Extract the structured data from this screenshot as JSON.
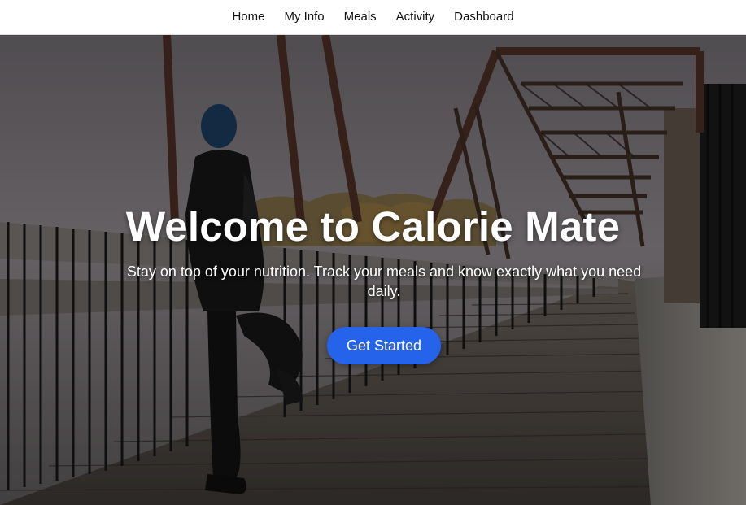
{
  "nav": {
    "items": [
      {
        "label": "Home"
      },
      {
        "label": "My Info"
      },
      {
        "label": "Meals"
      },
      {
        "label": "Activity"
      },
      {
        "label": "Dashboard"
      }
    ]
  },
  "hero": {
    "title": "Welcome to Calorie Mate",
    "subtitle": "Stay on top of your nutrition. Track your meals and know exactly what you need daily.",
    "cta_label": "Get Started",
    "image_description": "runner-stretching-on-bridge-photo"
  },
  "colors": {
    "accent": "#2563eb",
    "nav_bg": "#ffffff",
    "text_on_hero": "#ffffff"
  }
}
